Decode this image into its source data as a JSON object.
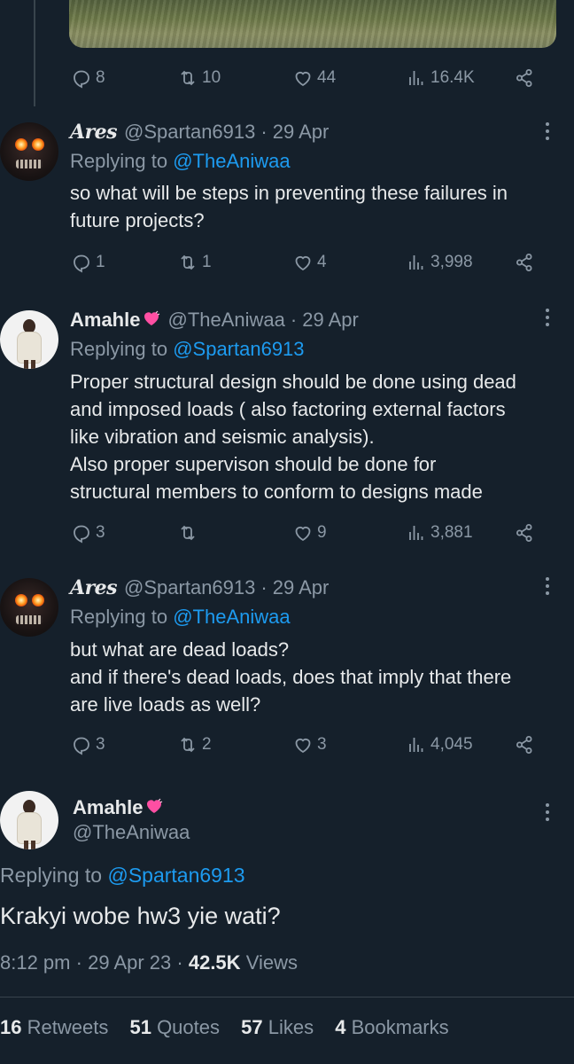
{
  "top_tweet": {
    "replies": "8",
    "retweets": "10",
    "likes": "44",
    "views": "16.4K"
  },
  "reply1": {
    "name": "Ares",
    "handle": "@Spartan6913",
    "date": "29 Apr",
    "replying_prefix": "Replying to",
    "replying_to": "@TheAniwaa",
    "text": "so what will be steps in preventing these failures in\nfuture projects?",
    "replies": "1",
    "retweets": "1",
    "likes": "4",
    "views": "3,998"
  },
  "reply2": {
    "name": "Amahle",
    "handle": "@TheAniwaa",
    "date": "29 Apr",
    "replying_prefix": "Replying to",
    "replying_to": "@Spartan6913",
    "text": "Proper structural design  should be done using dead\nand imposed loads ( also factoring external factors\nlike vibration  and seismic analysis).\nAlso proper supervison should be done for\nstructural members to conform to designs made",
    "replies": "3",
    "retweets": "",
    "likes": "9",
    "views": "3,881"
  },
  "reply3": {
    "name": "Ares",
    "handle": "@Spartan6913",
    "date": "29 Apr",
    "replying_prefix": "Replying to",
    "replying_to": "@TheAniwaa",
    "text": "but what are dead loads?\nand if there's dead loads, does that imply that there\nare live loads as well?",
    "replies": "3",
    "retweets": "2",
    "likes": "3",
    "views": "4,045"
  },
  "main": {
    "name": "Amahle",
    "handle": "@TheAniwaa",
    "replying_prefix": "Replying to",
    "replying_to": "@Spartan6913",
    "text": "Krakyi wobe hw3 yie wati?",
    "time": "8:12 pm",
    "date": "29 Apr 23",
    "views_count": "42.5K",
    "views_label": "Views",
    "retweets_count": "16",
    "retweets_label": "Retweets",
    "quotes_count": "51",
    "quotes_label": "Quotes",
    "likes_count": "57",
    "likes_label": "Likes",
    "bookmarks_count": "4",
    "bookmarks_label": "Bookmarks"
  },
  "colors": {
    "background": "#15202b",
    "text": "#e7e9ea",
    "muted": "#8b98a5",
    "link": "#1d9bf0",
    "heart_emoji": "#ff4fa3"
  },
  "icons": [
    "reply-icon",
    "retweet-icon",
    "like-icon",
    "views-icon",
    "share-icon",
    "more-icon",
    "heart-emoji-icon"
  ]
}
